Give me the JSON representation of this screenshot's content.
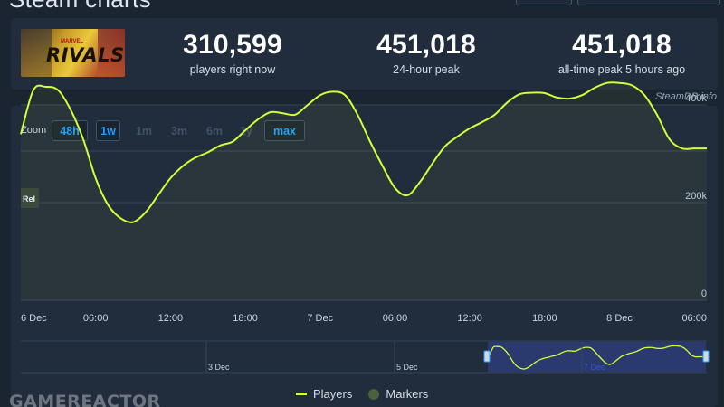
{
  "page": {
    "title": "Steam charts"
  },
  "game": {
    "logo_text": "RIVALS",
    "logo_sup": "MARVEL"
  },
  "stats": [
    {
      "value": "310,599",
      "label": "players right now"
    },
    {
      "value": "451,018",
      "label": "24-hour peak"
    },
    {
      "value": "451,018",
      "label": "all-time peak 5 hours ago"
    }
  ],
  "credit": "SteamDB.info",
  "zoom": {
    "label": "Zoom",
    "options": [
      {
        "label": "48h",
        "active": true
      },
      {
        "label": "1w",
        "active": true
      },
      {
        "label": "1m",
        "active": false
      },
      {
        "label": "3m",
        "active": false
      },
      {
        "label": "6m",
        "active": false
      },
      {
        "label": "1y",
        "active": false
      },
      {
        "label": "max",
        "active": true
      }
    ]
  },
  "release_marker": "Rel",
  "legend": {
    "players": "Players",
    "markers": "Markers"
  },
  "watermark": "GAMEREACTOR",
  "colors": {
    "line": "#d1ff3a",
    "accent": "#1a9fff",
    "marker": "#4b6139",
    "nav_selection": "#2b3a6e"
  },
  "chart_data": {
    "type": "line",
    "title": "",
    "xlabel": "",
    "ylabel": "",
    "x_ticks": [
      "6 Dec",
      "06:00",
      "12:00",
      "18:00",
      "7 Dec",
      "06:00",
      "12:00",
      "18:00",
      "8 Dec",
      "06:00"
    ],
    "y_ticks": [
      "0",
      "200k",
      "400k"
    ],
    "ylim": [
      0,
      400000
    ],
    "x_hours": [
      0,
      1,
      2,
      3,
      4,
      5,
      6,
      7,
      8,
      9,
      10,
      11,
      12,
      13,
      14,
      15,
      16,
      17,
      18,
      19,
      20,
      21,
      22,
      23,
      24,
      25,
      26,
      27,
      28,
      29,
      30,
      31,
      32,
      33,
      34,
      35,
      36,
      37,
      38,
      39,
      40,
      41,
      42,
      43,
      44,
      45,
      46,
      47,
      48,
      49,
      50,
      51,
      52,
      53,
      54,
      55
    ],
    "series": [
      {
        "name": "Players",
        "values": [
          340000,
          430000,
          437000,
          430000,
          390000,
          330000,
          250000,
          195000,
          168000,
          160000,
          180000,
          215000,
          250000,
          275000,
          292000,
          303000,
          317000,
          325000,
          348000,
          370000,
          385000,
          383000,
          380000,
          400000,
          420000,
          427000,
          420000,
          380000,
          325000,
          275000,
          230000,
          215000,
          242000,
          280000,
          315000,
          335000,
          352000,
          365000,
          380000,
          405000,
          422000,
          425000,
          424000,
          415000,
          413000,
          420000,
          435000,
          445000,
          445000,
          440000,
          420000,
          380000,
          330000,
          311000,
          311000,
          311000
        ]
      }
    ],
    "navigator": {
      "x_ticks": [
        "3 Dec",
        "5 Dec",
        "7 Dec"
      ],
      "selected_range": [
        "6 Dec",
        "8 Dec"
      ]
    },
    "legend_position": "bottom-center",
    "grid": true
  }
}
